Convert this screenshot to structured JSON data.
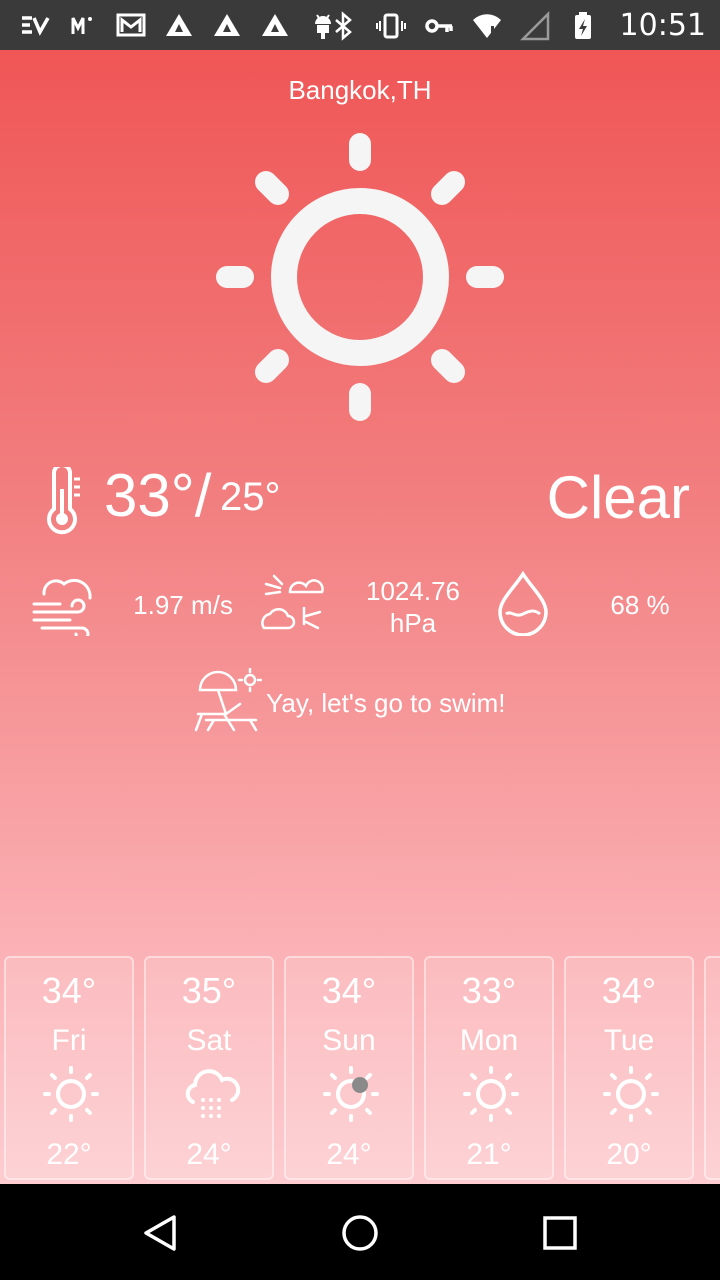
{
  "status_bar": {
    "time": "10:51",
    "left_icons": [
      "ev-icon",
      "m-mail-icon",
      "gmail-icon",
      "delta-icon-1",
      "delta-icon-2",
      "delta-icon-3",
      "android-icon"
    ],
    "right_icons": [
      "bluetooth-icon",
      "vibrate-icon",
      "key-icon",
      "wifi-icon",
      "signal-icon",
      "battery-charging-icon"
    ]
  },
  "weather": {
    "city": "Bangkok,TH",
    "temp_max": "33°",
    "temp_sep": "/",
    "temp_min": "25°",
    "condition": "Clear",
    "wind": "1.97 m/s",
    "pressure_value": "1024.76",
    "pressure_unit": "hPa",
    "humidity": "68 %",
    "advice": "Yay, let's go to swim!"
  },
  "forecast": [
    {
      "high": "34°",
      "day": "Fri",
      "icon": "sun-icon",
      "low": "22°"
    },
    {
      "high": "35°",
      "day": "Sat",
      "icon": "rain-cloud-icon",
      "low": "24°"
    },
    {
      "high": "34°",
      "day": "Sun",
      "icon": "sun-icon",
      "low": "24°"
    },
    {
      "high": "33°",
      "day": "Mon",
      "icon": "sun-icon",
      "low": "21°"
    },
    {
      "high": "34°",
      "day": "Tue",
      "icon": "sun-icon",
      "low": "20°"
    }
  ],
  "colors": {
    "gradient_top": "#f05656",
    "gradient_bottom": "#fdcdd1",
    "status_bar": "#3a3a3a",
    "nav_bar": "#000000"
  }
}
